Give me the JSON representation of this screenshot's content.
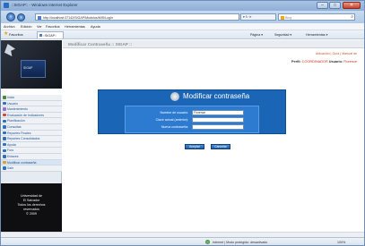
{
  "window": {
    "title": "::SIGAP:: - Windows Internet Explorer",
    "controls": {
      "minimize": "–",
      "maximize": "□",
      "close": "✕"
    }
  },
  "address_bar": {
    "back_icon": "back-arrow-icon",
    "forward_icon": "forward-arrow-icon",
    "url": "http://localhost:37142/SIGAP/Modulos/MIS/Login",
    "tools": "▾ ↻ ✕",
    "search_placeholder": "Bing",
    "search_icon": "magnifier-icon"
  },
  "menu_bar": [
    "Archivo",
    "Edición",
    "Ver",
    "Favoritos",
    "Herramientas",
    "Ayuda"
  ],
  "favorites_bar": {
    "favorites_label": "Favoritos",
    "tab_title": "::SIGAP::",
    "commands": [
      "Página ▾",
      "Seguridad ▾",
      "Herramientas ▾"
    ]
  },
  "sidebar": {
    "logo_text": "SIGAP",
    "menu_title": "",
    "items": [
      {
        "label": "Inicio",
        "icon_color": "#4a8a2e"
      },
      {
        "label": "Usuario",
        "icon_color": "#2f6fc0"
      },
      {
        "label": "Mantenimiento",
        "icon_color": "#9c6ad0"
      },
      {
        "label": "Evaluación de Indicadores",
        "icon_color": "#d24a2e"
      },
      {
        "label": "Planificación",
        "icon_color": "#2f6fc0"
      },
      {
        "label": "Consultas",
        "icon_color": "#2f6fc0"
      },
      {
        "label": "Reportes Finales",
        "icon_color": "#2f6fc0"
      },
      {
        "label": "Reportes Consolidados",
        "icon_color": "#2f6fc0"
      },
      {
        "label": "Ayuda",
        "icon_color": "#2f6fc0"
      },
      {
        "label": "Foro",
        "icon_color": "#2f6fc0"
      },
      {
        "label": "Enlaces",
        "icon_color": "#2f6fc0"
      },
      {
        "label": "Modificar contraseña",
        "icon_color": "#d2a22e"
      },
      {
        "label": "Salir",
        "icon_color": "#2f6fc0"
      }
    ],
    "footer": [
      "Universidad de",
      "El Salvador",
      "Todos los derechos",
      "reservados",
      "© 2009"
    ]
  },
  "main": {
    "header": "Modificar Contraseña :: SIGAP ::",
    "top_links": "Ubicación | Guía | Manual de",
    "profile_label": "Perfil:",
    "profile_value": "COORDINADOR",
    "user_label": "Usuario:",
    "user_value": "Florence",
    "form": {
      "title": "Modificar contraseña",
      "fields": [
        {
          "label": "Nombre de usuario:",
          "value": "Florence"
        },
        {
          "label": "Clave actual (anterior):",
          "value": ""
        },
        {
          "label": "Nueva contraseña:",
          "value": ""
        }
      ],
      "accept_label": "Aceptar",
      "cancel_label": "Cancelar"
    }
  },
  "status_bar": {
    "zone": "Internet | Modo protegido: desactivado",
    "zoom": "100%"
  }
}
